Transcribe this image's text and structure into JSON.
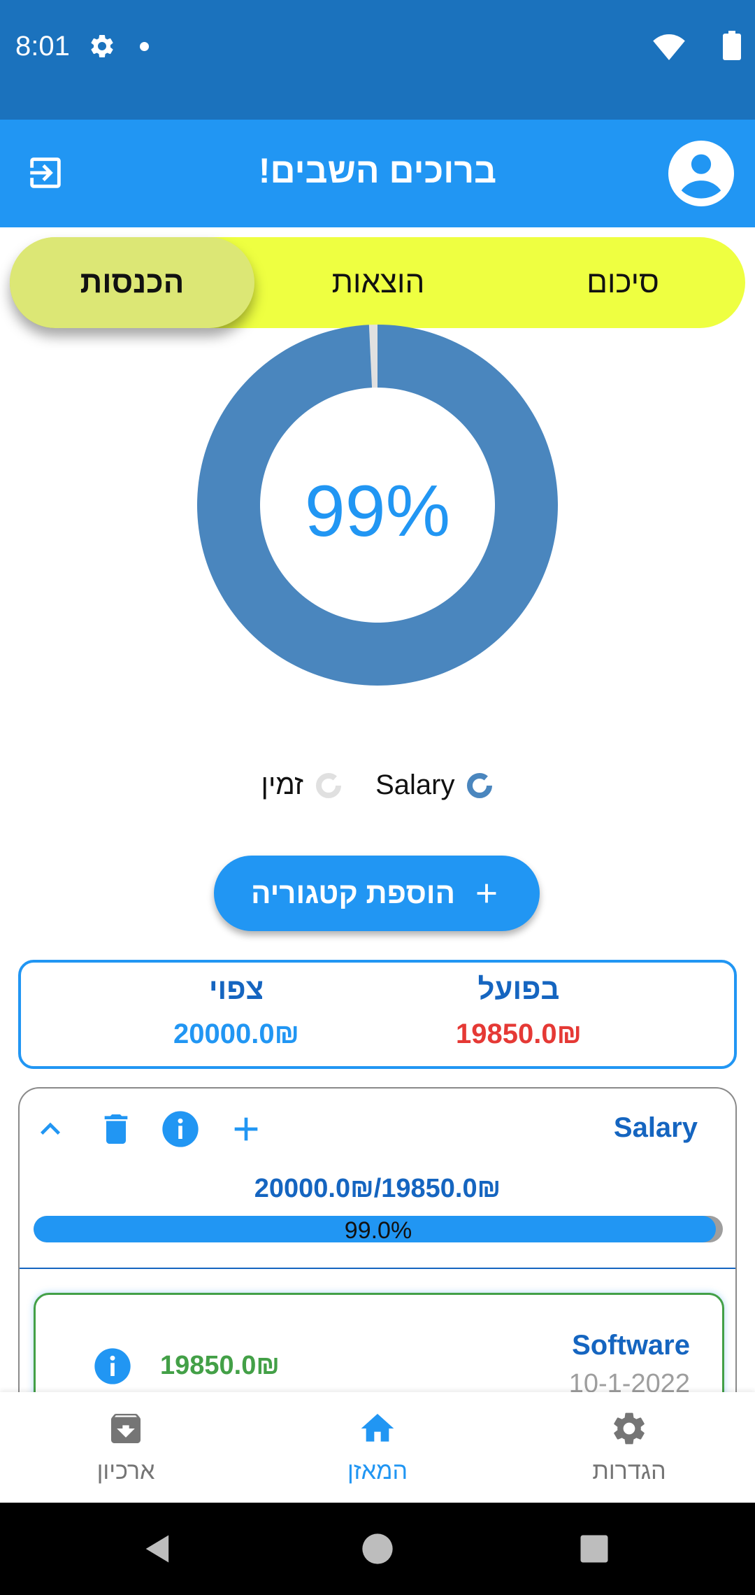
{
  "status_bar": {
    "time": "8:01",
    "icons": [
      "settings-icon",
      "notification-dot",
      "wifi-icon",
      "battery-icon"
    ]
  },
  "app_bar": {
    "title": "ברוכים השבים!",
    "icons": [
      "logout-icon",
      "account-circle-icon"
    ]
  },
  "tabs": [
    {
      "label": "סיכום",
      "selected": false
    },
    {
      "label": "הוצאות",
      "selected": false
    },
    {
      "label": "הכנסות",
      "selected": true
    }
  ],
  "chart_data": {
    "type": "pie",
    "style": "donut",
    "center_label": "99%",
    "slices": [
      {
        "label": "Salary",
        "value": 19850,
        "color": "#4a86be"
      },
      {
        "label": "זמין",
        "value": 150,
        "color": "#e0e0e0"
      }
    ],
    "legend_placement": "bottom"
  },
  "legend": [
    {
      "label": "Salary",
      "color": "#4a86be"
    },
    {
      "label": "זמין",
      "color": "#e0e0e0"
    }
  ],
  "add_category": {
    "label": "הוספת קטגוריה",
    "icon": "plus-icon"
  },
  "totals": {
    "actual_label": "בפועל",
    "actual_value": "19850.0₪",
    "expected_label": "צפוי",
    "expected_value": "20000.0₪"
  },
  "category": {
    "name": "Salary",
    "amount_text": "20000.0₪/19850.0₪",
    "progress": 0.99,
    "progress_label": "99.0%",
    "icons": [
      "collapse-icon",
      "delete-icon",
      "info-icon",
      "add-icon"
    ]
  },
  "transaction": {
    "name": "Software",
    "date": "10-1-2022",
    "amount": "19850.0₪"
  },
  "bottom_nav": [
    {
      "label": "ארכיון",
      "icon": "archive-icon",
      "selected": false
    },
    {
      "label": "המאזן",
      "icon": "home-icon",
      "selected": true
    },
    {
      "label": "הגדרות",
      "icon": "settings-icon",
      "selected": false
    }
  ],
  "colors": {
    "status_bar": "#1b72bd",
    "app_bar": "#2196f3",
    "tabs_bg": "#eeff41",
    "tab_selected": "#dce775",
    "actual": "#e53935",
    "income": "#43a047",
    "category_text": "#1565c0"
  }
}
